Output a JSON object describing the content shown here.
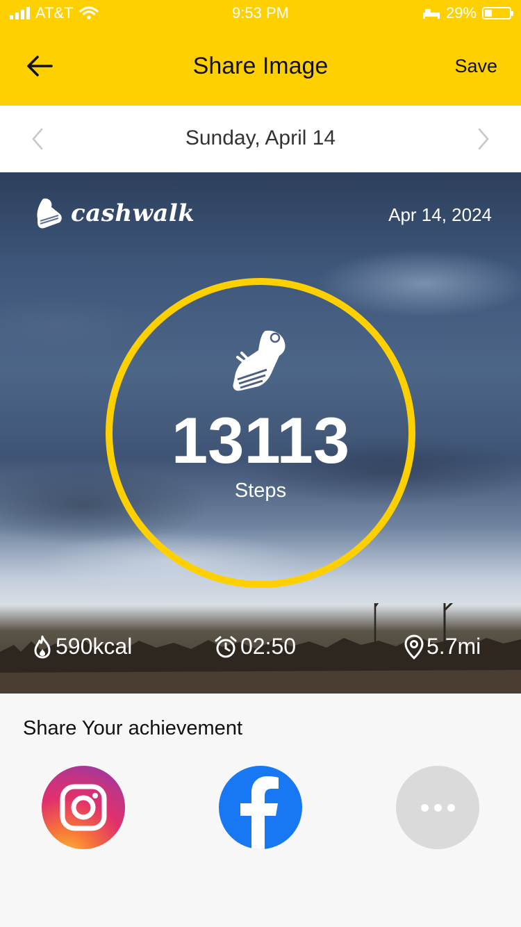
{
  "status_bar": {
    "carrier": "AT&T",
    "time": "9:53 PM",
    "battery_percent": "29%",
    "battery_level": 0.29
  },
  "header": {
    "title": "Share Image",
    "save_label": "Save",
    "back_icon": "arrow-left-icon",
    "background_color": "#ffd000"
  },
  "date_nav": {
    "label": "Sunday, April 14",
    "prev_icon": "chevron-left-icon",
    "next_icon": "chevron-right-icon"
  },
  "share_image": {
    "brand": "cashwalk",
    "date": "Apr 14, 2024",
    "steps_value": "13113",
    "steps_label": "Steps",
    "ring_color": "#ffd000",
    "stats": {
      "calories": "590kcal",
      "duration": "02:50",
      "distance": "5.7mi"
    }
  },
  "share_section": {
    "title": "Share Your achievement",
    "buttons": [
      "instagram",
      "facebook",
      "more"
    ]
  }
}
